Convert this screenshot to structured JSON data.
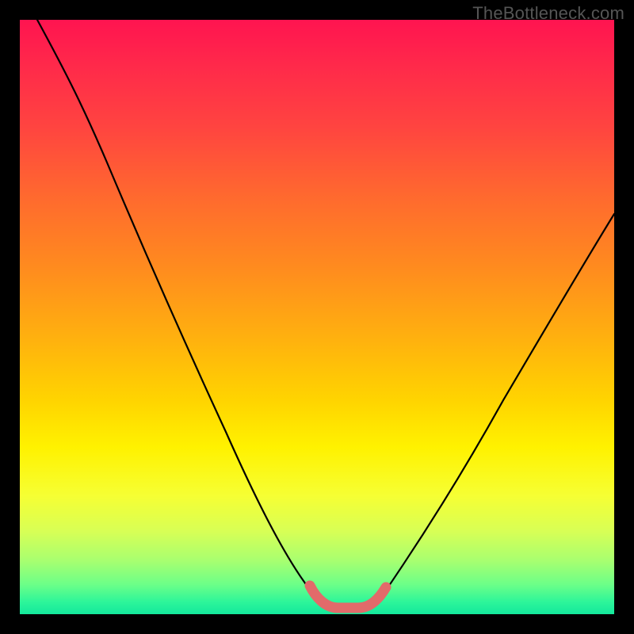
{
  "watermark": "TheBottleneck.com",
  "chart_data": {
    "type": "line",
    "title": "",
    "xlabel": "",
    "ylabel": "",
    "xlim": [
      0,
      1
    ],
    "ylim": [
      0,
      1
    ],
    "series": [
      {
        "name": "bottleneck-curve",
        "x": [
          0.03,
          0.1,
          0.17,
          0.24,
          0.31,
          0.38,
          0.45,
          0.5,
          0.535,
          0.57,
          0.605,
          0.66,
          0.73,
          0.8,
          0.87,
          0.94,
          1.0
        ],
        "y": [
          1.0,
          0.87,
          0.73,
          0.59,
          0.45,
          0.31,
          0.17,
          0.06,
          0.01,
          0.01,
          0.01,
          0.07,
          0.18,
          0.3,
          0.43,
          0.56,
          0.67
        ]
      },
      {
        "name": "highlight-segment",
        "x": [
          0.5,
          0.535,
          0.57,
          0.605
        ],
        "y": [
          0.055,
          0.015,
          0.015,
          0.055
        ]
      }
    ],
    "annotations": [],
    "gradient_bg": {
      "top": "#ff1450",
      "mid_upper": "#ff8c1e",
      "mid": "#fff200",
      "bottom": "#14e89c"
    }
  },
  "colors": {
    "page_bg": "#000000",
    "watermark": "#555555",
    "curve": "#000000",
    "highlight": "#e26a6a"
  }
}
